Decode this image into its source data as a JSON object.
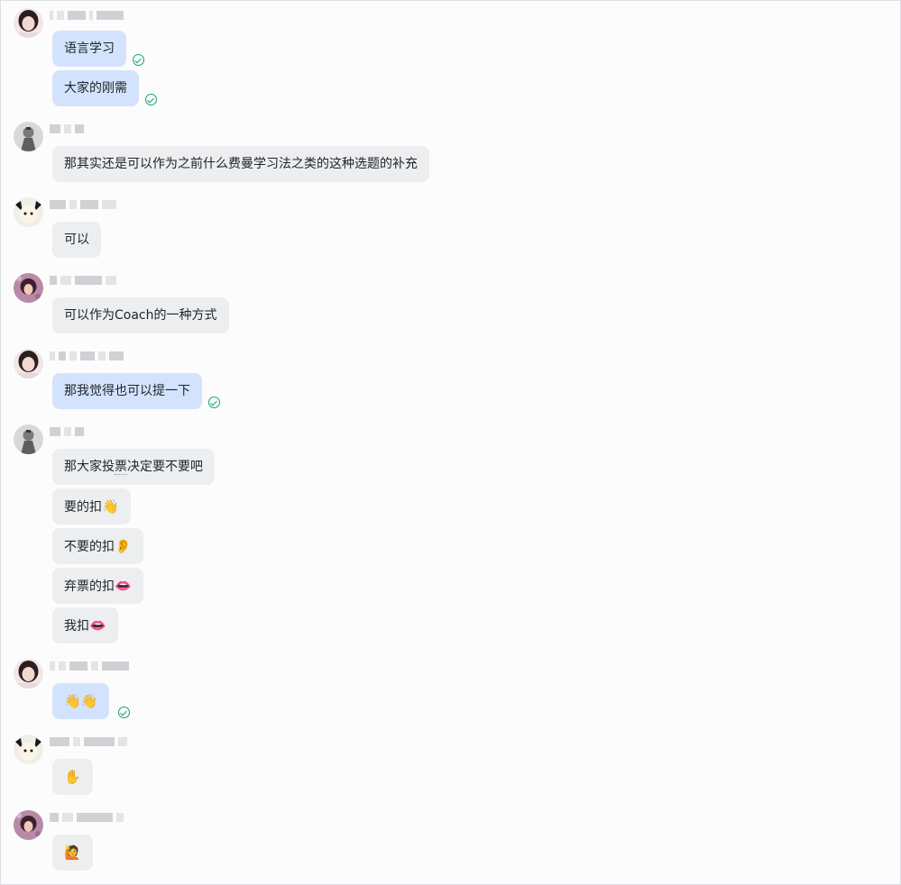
{
  "conversation": {
    "messages": [
      {
        "sender": "user-a",
        "bubbles": [
          "语言学习",
          "大家的刚需"
        ],
        "mine": true
      },
      {
        "sender": "user-b",
        "bubbles": [
          "那其实还是可以作为之前什么费曼学习法之类的这种选题的补充"
        ],
        "mine": false
      },
      {
        "sender": "user-c",
        "bubbles": [
          "可以"
        ],
        "mine": false
      },
      {
        "sender": "user-d",
        "bubbles": [
          "可以作为Coach的一种方式"
        ],
        "mine": false
      },
      {
        "sender": "user-a",
        "bubbles": [
          "那我觉得也可以提一下"
        ],
        "mine": true
      },
      {
        "sender": "user-b",
        "bubbles": [
          "那大家投票决定要不要吧",
          "要的扣👋",
          "不要的扣👂",
          "弃票的扣👄",
          "我扣👄"
        ],
        "mine": false
      },
      {
        "sender": "user-a",
        "bubbles": [
          "👋👋"
        ],
        "mine": true
      },
      {
        "sender": "user-c",
        "bubbles": [
          "✋"
        ],
        "mine": false
      },
      {
        "sender": "user-d",
        "bubbles": [
          "🙋"
        ],
        "mine": false
      }
    ]
  },
  "g1": {
    "b1": "语言学习",
    "b2": "大家的刚需"
  },
  "g2": {
    "b1": "那其实还是可以作为之前什么费曼学习法之类的这种选题的补充"
  },
  "g3": {
    "b1": "可以"
  },
  "g4": {
    "b1": "可以作为Coach的一种方式"
  },
  "g5": {
    "b1": "那我觉得也可以提一下"
  },
  "g6": {
    "b1a": "那大家投",
    "b1b": "票",
    "b1c": "决定要不要吧",
    "b2": "要的扣",
    "b2e": "👋",
    "b3": "不要的扣",
    "b3e": "👂",
    "b4": "弃票的扣",
    "b4e": "👄",
    "b5": "我扣",
    "b5e": "👄"
  },
  "g7": {
    "b1": "👋👋"
  },
  "g8": {
    "b1": "✋"
  },
  "g9": {
    "b1": "🙋"
  },
  "colors": {
    "mine_bubble": "#d3e3fd",
    "other_bubble": "#eceef0",
    "read_check": "#10a37f"
  },
  "icons": {
    "read_receipt": "check-circle-icon"
  }
}
